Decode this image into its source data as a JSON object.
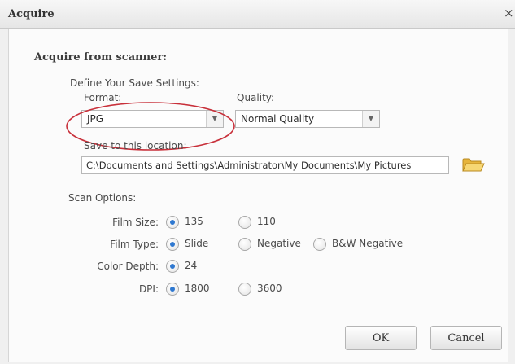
{
  "window": {
    "title": "Acquire",
    "close_glyph": "×"
  },
  "section_title": "Acquire from scanner:",
  "save_settings": {
    "title": "Define Your Save Settings:",
    "format_label": "Format:",
    "format_value": "JPG",
    "quality_label": "Quality:",
    "quality_value": "Normal Quality",
    "location_label": "Save to this location:",
    "location_value": "C:\\Documents and Settings\\Administrator\\My Documents\\My Pictures",
    "browse_icon": "folder-open-icon"
  },
  "scan_options": {
    "title": "Scan Options:",
    "film_size": {
      "label": "Film Size:",
      "options": [
        "135",
        "110"
      ],
      "selected": "135"
    },
    "film_type": {
      "label": "Film Type:",
      "options": [
        "Slide",
        "Negative",
        "B&W Negative"
      ],
      "selected": "Slide"
    },
    "color_depth": {
      "label": "Color Depth:",
      "options": [
        "24"
      ],
      "selected": "24"
    },
    "dpi": {
      "label": "DPI:",
      "options": [
        "1800",
        "3600"
      ],
      "selected": "1800"
    }
  },
  "buttons": {
    "ok": "OK",
    "cancel": "Cancel"
  },
  "colors": {
    "accent": "#2f78d0",
    "annotation": "#c8303a",
    "folder": "#f2c94c"
  }
}
